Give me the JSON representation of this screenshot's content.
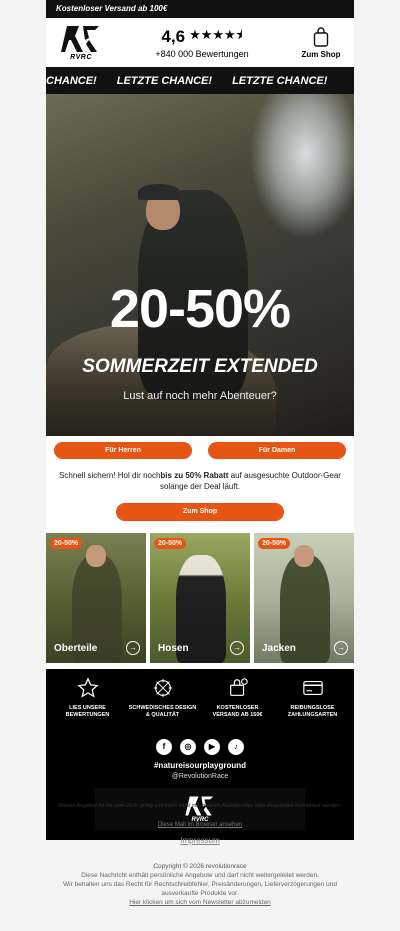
{
  "topbar": {
    "text": "Kostenloser Versand ab 100€"
  },
  "header": {
    "logo_text": "RVRC",
    "rating_score": "4,6",
    "stars": "★★★★⯨",
    "reviews": "+840 000 Bewertungen",
    "shop_label": "Zum Shop"
  },
  "marquee": {
    "items": [
      "CHANCE!",
      "LETZTE CHANCE!",
      "LETZTE CHANCE!"
    ]
  },
  "hero": {
    "headline": "20-50%",
    "subheadline": "SOMMERZEIT EXTENDED",
    "tagline": "Lust auf noch mehr Abenteuer?"
  },
  "buttons": {
    "men": "Für Herren",
    "women": "Für Damen",
    "shop": "Zum Shop"
  },
  "promo": {
    "before": "Schnell sichern! Hol dir noch",
    "bold": "bis zu 50% Rabatt",
    "after": " auf ausgesuchte Outdoor-Gear solange der Deal läuft."
  },
  "categories": [
    {
      "badge": "20-50%",
      "label": "Oberteile"
    },
    {
      "badge": "20-50%",
      "label": "Hosen"
    },
    {
      "badge": "20-50%",
      "label": "Jacken"
    }
  ],
  "features": [
    {
      "icon": "star-icon",
      "label": "LIES UNSERE BEWERTUNGEN"
    },
    {
      "icon": "compass-icon",
      "label": "SCHWEDISCHES DESIGN & QUALITÄT"
    },
    {
      "icon": "delivery-icon",
      "label": "KOSTENLOSER VERSAND AB 150€"
    },
    {
      "icon": "credit-card-icon",
      "label": "REIBUNGSLOSE ZAHLUNGSARTEN"
    }
  ],
  "social": {
    "hashtag": "#natureisourplayground",
    "handle": "@RevolutionRace"
  },
  "legal": {
    "note": "Dieses Angebot ist bis zum 26.8. gültig und kann nicht mit anderen Rabattcodes oder Angeboten kombiniert werden.",
    "browser": "Diese Mail im Browser ansehen",
    "impressum": "Impressum",
    "copyright": "Copyright © 2026 revolutionrace",
    "copy1": "Diese Nachricht enthält persönliche Angebote und darf nicht weitergeleitet werden.",
    "copy2": "Wir behalten uns das Recht für Rechtschreibfehler, Preisänderungen, Lieferverzögerungen und ausverkaufte Produkte vor.",
    "unsubscribe": "Hier klicken um sich vom Newsletter abzumelden"
  },
  "colors": {
    "accent": "#e65514",
    "dark": "#111111"
  }
}
